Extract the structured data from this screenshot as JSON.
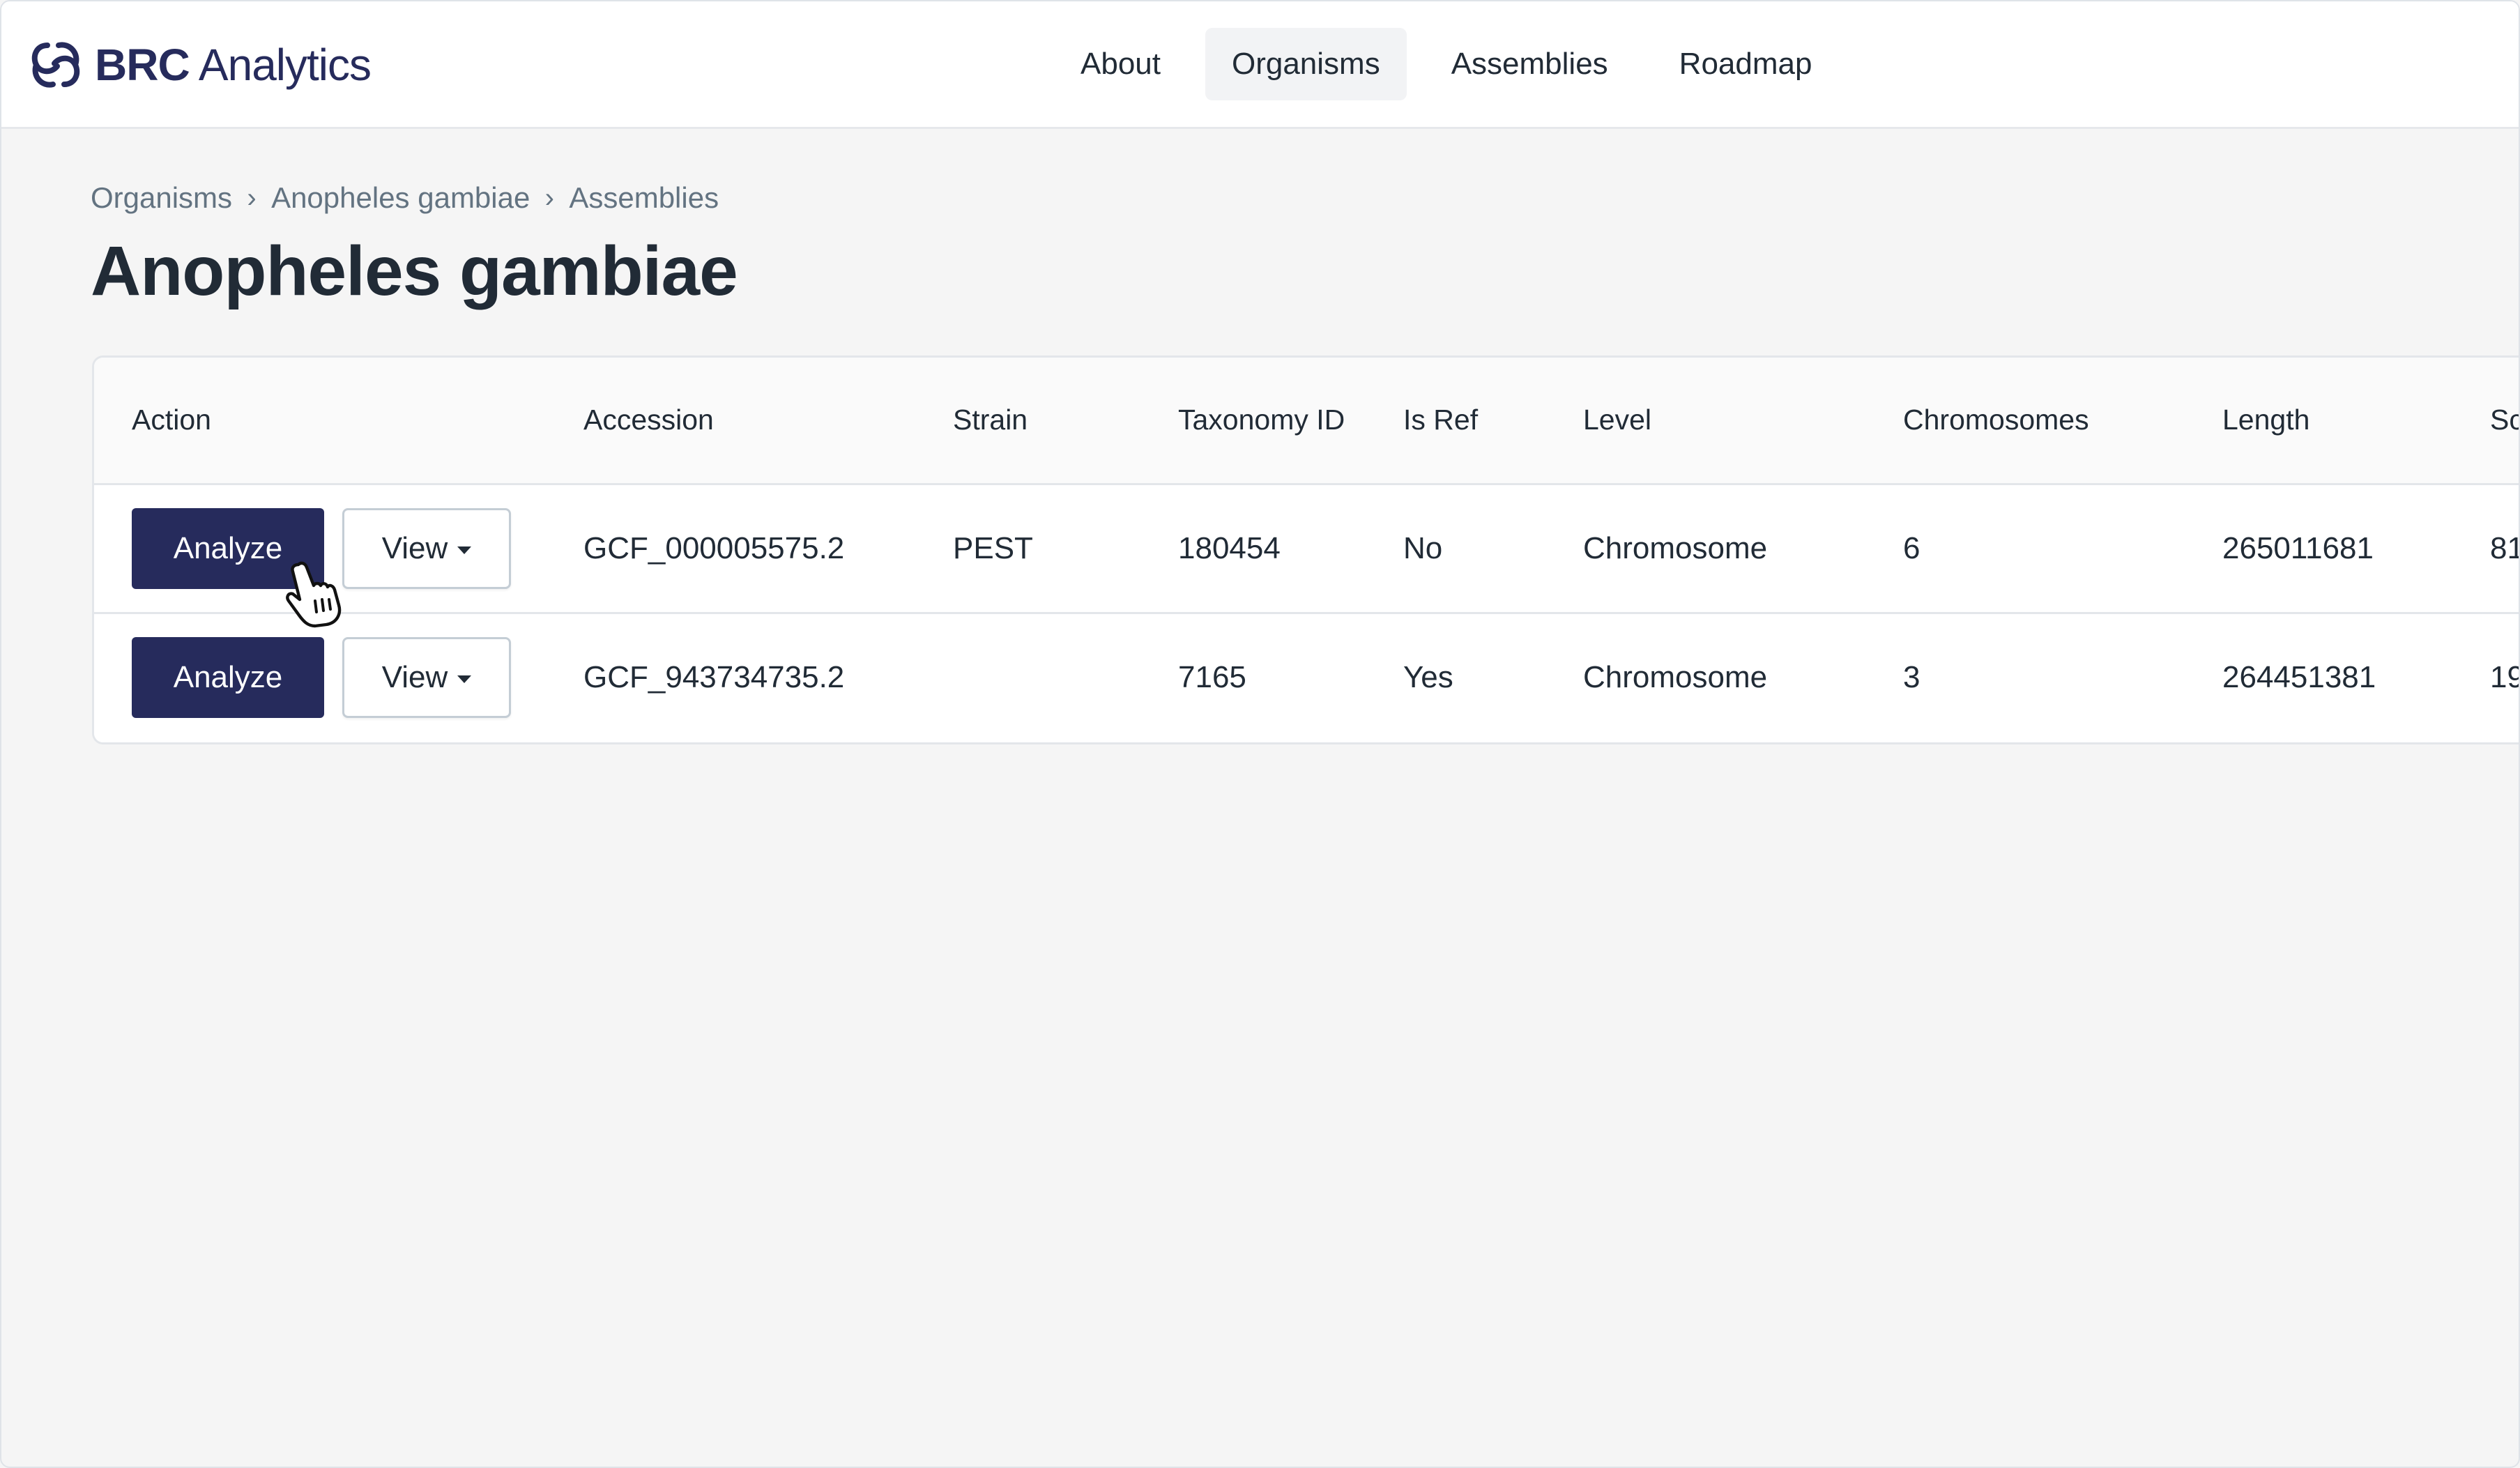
{
  "header": {
    "logo": {
      "brand": "BRC",
      "product": "Analytics"
    },
    "nav": [
      {
        "label": "About",
        "active": false
      },
      {
        "label": "Organisms",
        "active": true
      },
      {
        "label": "Assemblies",
        "active": false
      },
      {
        "label": "Roadmap",
        "active": false
      }
    ]
  },
  "breadcrumb": [
    "Organisms",
    "Anopheles gambiae",
    "Assemblies"
  ],
  "page_title": "Anopheles gambiae",
  "table": {
    "columns": {
      "action": "Action",
      "accession": "Accession",
      "strain": "Strain",
      "taxonomy_id": "Taxonomy ID",
      "is_ref": "Is Ref",
      "level": "Level",
      "chromosomes": "Chromosomes",
      "length": "Length",
      "sc_partial": "Sc"
    },
    "rows": [
      {
        "analyze_label": "Analyze",
        "view_label": "View",
        "accession": "GCF_000005575.2",
        "strain": "PEST",
        "taxonomy_id": "180454",
        "is_ref": "No",
        "level": "Chromosome",
        "chromosomes": "6",
        "length": "265011681",
        "sc_partial": "81"
      },
      {
        "analyze_label": "Analyze",
        "view_label": "View",
        "accession": "GCF_943734735.2",
        "strain": "",
        "taxonomy_id": "7165",
        "is_ref": "Yes",
        "level": "Chromosome",
        "chromosomes": "3",
        "length": "264451381",
        "sc_partial": "19"
      }
    ]
  },
  "colors": {
    "brand_navy": "#262b5c",
    "page_bg": "#f5f5f5",
    "text": "#212b36",
    "muted": "#637381"
  },
  "icons": {
    "logo": "brc-logo-icon",
    "breadcrumb_separator": "chevron-right-icon",
    "dropdown": "caret-down-icon",
    "cursor": "hand-pointer-icon"
  }
}
